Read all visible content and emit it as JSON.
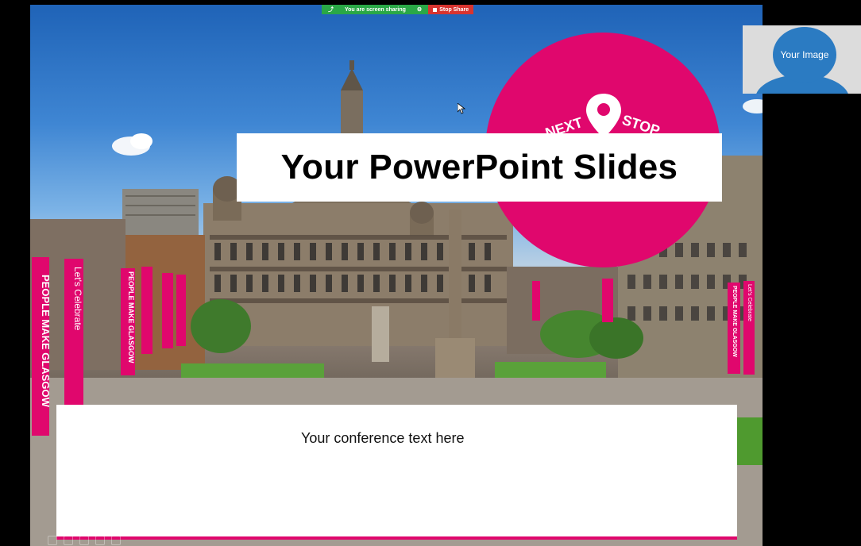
{
  "share_bar": {
    "sharing_label": "You are screen sharing",
    "stop_label": "Stop Share"
  },
  "video_tile": {
    "label": "Your Image"
  },
  "slide": {
    "title": "Your PowerPoint Slides",
    "body_text": "Your conference text here",
    "badge_left": "NEXT",
    "badge_right": "STOP",
    "banner_left_1": "PEOPLE MAKE GLASGOW",
    "banner_left_2": "Let's Celebrate",
    "banner_left_3": "PEOPLE MAKE GLASGOW",
    "banner_right_1": "PEOPLE MAKE GLASGOW",
    "banner_right_2": "Let's Celebrate"
  },
  "colors": {
    "accent": "#e0076d",
    "sky": "#3f86d3",
    "sharing_green": "#2aa846",
    "stop_red": "#d8342f",
    "video_blue": "#2b7bc2"
  }
}
